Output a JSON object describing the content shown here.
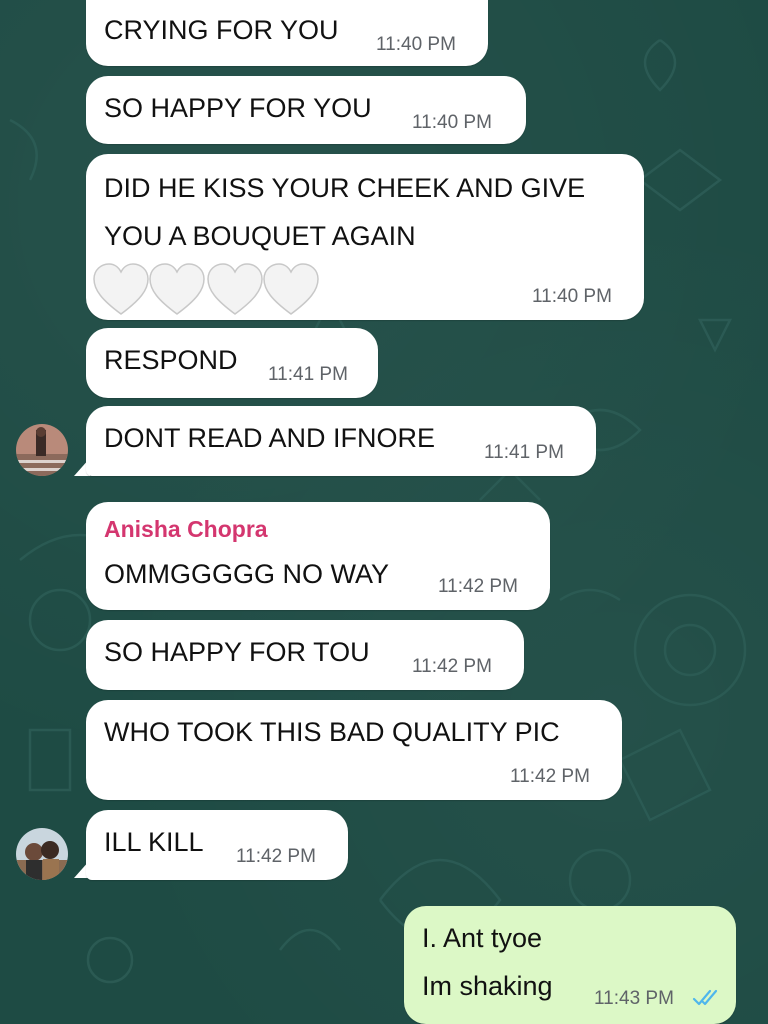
{
  "messages": [
    {
      "text": "CRYING FOR YOU",
      "time": "11:40 PM"
    },
    {
      "text": "SO HAPPY FOR YOU",
      "time": "11:40 PM"
    },
    {
      "line1": "DID HE KISS YOUR CHEEK AND GIVE",
      "line2": "YOU A BOUQUET AGAIN",
      "time": "11:40 PM",
      "hearts": "🤍🤍🤍🤍"
    },
    {
      "text": "RESPOND",
      "time": "11:41 PM"
    },
    {
      "text": "DONT READ AND IFNORE",
      "time": "11:41 PM"
    },
    {
      "sender": "Anisha Chopra",
      "text": "OMMGGGGG NO WAY",
      "time": "11:42 PM"
    },
    {
      "text": "SO HAPPY FOR TOU",
      "time": "11:42 PM"
    },
    {
      "text": "WHO TOOK THIS BAD QUALITY PIC",
      "time": "11:42 PM"
    },
    {
      "text": "ILL KILL",
      "time": "11:42 PM"
    },
    {
      "line1": "I. Ant tyoe",
      "line2": "Im shaking",
      "time": "11:43 PM",
      "status": "read"
    }
  ],
  "colors": {
    "background": "#1e4b44",
    "incoming_bubble": "#ffffff",
    "outgoing_bubble": "#dcf8c6",
    "sender_name": "#d4366f",
    "read_ticks": "#4fb6ec"
  },
  "icons": [
    "double-check-icon",
    "avatar"
  ]
}
